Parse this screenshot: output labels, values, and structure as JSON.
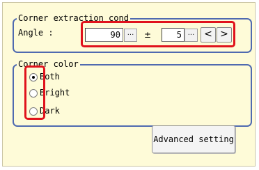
{
  "corner_extraction": {
    "title": "Corner extraction cond",
    "angle_label": "Angle :",
    "angle_value": "90",
    "pm_symbol": "±",
    "tolerance_value": "5",
    "ellipsis": "...",
    "prev_symbol": "<",
    "next_symbol": ">"
  },
  "corner_color": {
    "title": "Corner color",
    "options": [
      {
        "label": "Both",
        "selected": true
      },
      {
        "label": "Bright",
        "selected": false
      },
      {
        "label": "Dark",
        "selected": false
      }
    ]
  },
  "advanced_button_label": "Advanced setting",
  "highlight_color": "#e0121c",
  "group_border_color": "#4f6ab0",
  "panel_background": "#fefbd8"
}
